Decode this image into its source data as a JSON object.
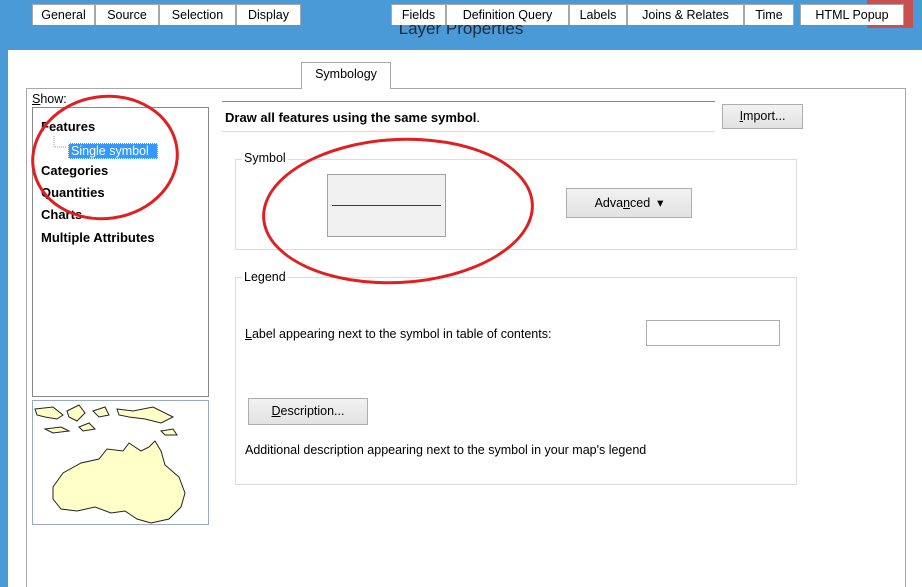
{
  "window": {
    "title": "Layer Properties",
    "close_glyph": "✕",
    "titlebar_color": "#4a9ad8",
    "close_color": "#c75050"
  },
  "tabs": [
    {
      "label": "General",
      "active": false
    },
    {
      "label": "Source",
      "active": false
    },
    {
      "label": "Selection",
      "active": false
    },
    {
      "label": "Display",
      "active": false
    },
    {
      "label": "Symbology",
      "active": true
    },
    {
      "label": "Fields",
      "active": false
    },
    {
      "label": "Definition Query",
      "active": false
    },
    {
      "label": "Labels",
      "active": false
    },
    {
      "label": "Joins & Relates",
      "active": false
    },
    {
      "label": "Time",
      "active": false
    },
    {
      "label": "HTML Popup",
      "active": false
    }
  ],
  "show_panel": {
    "label_prefix": "S",
    "label_rest": "how:",
    "items": [
      {
        "label": "Features"
      },
      {
        "label": "Single symbol",
        "selected": true
      },
      {
        "label": "Categories"
      },
      {
        "label": "Quantities"
      },
      {
        "label": "Charts"
      },
      {
        "label": "Multiple Attributes"
      }
    ]
  },
  "main": {
    "heading_bold": "Draw all features using the same symbol",
    "heading_suffix": ".",
    "import_prefix": "I",
    "import_rest": "mport..."
  },
  "symbol_group": {
    "label": "Symbol",
    "advanced_pre": "Adva",
    "advanced_u": "n",
    "advanced_post": "ced",
    "advanced_arrow": "▾",
    "line_color": "#1a3a9a"
  },
  "legend_group": {
    "label": "Legend",
    "label_text_u": "L",
    "label_text_rest": "abel appearing next to the symbol in table of contents:",
    "label_value": "",
    "description_u": "D",
    "description_rest": "escription...",
    "additional_text": "Additional description appearing next to the symbol in your map's legend"
  },
  "annotation_color": "#e02020"
}
